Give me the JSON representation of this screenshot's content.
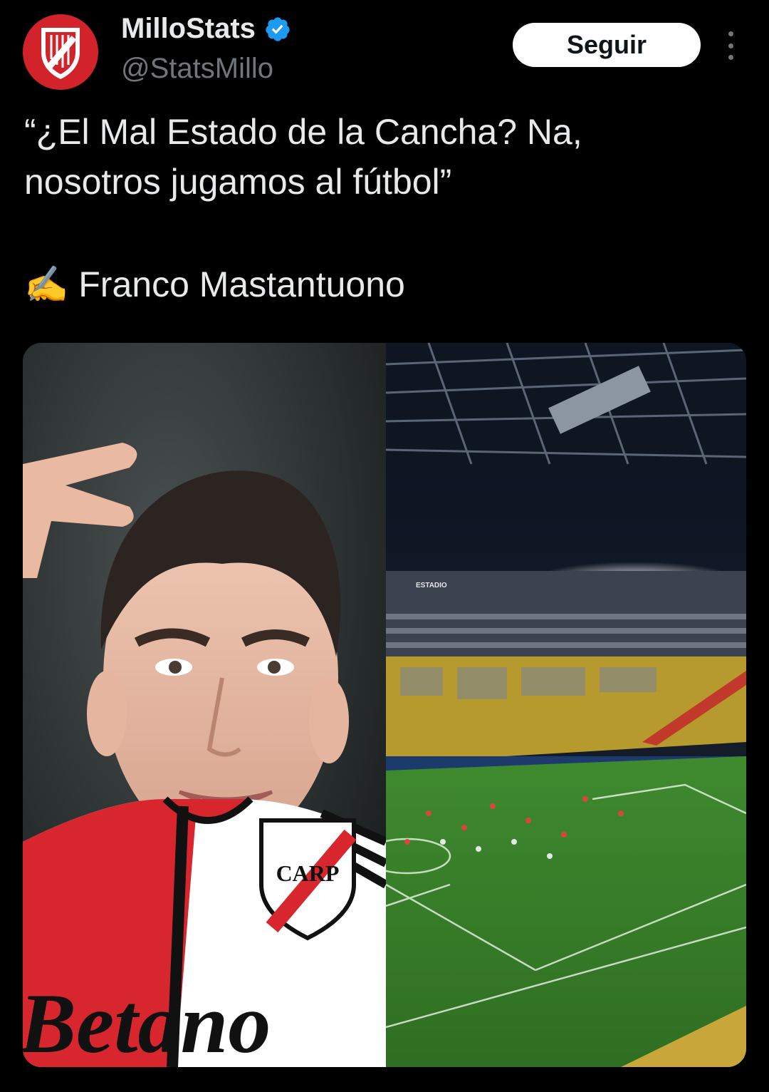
{
  "account": {
    "display_name": "MilloStats",
    "handle": "@StatsMillo",
    "verified_icon": "verified-badge-icon",
    "avatar_icon": "river-plate-crest-icon"
  },
  "follow_button": {
    "label": "Seguir"
  },
  "more_menu": {
    "icon": "more-vertical-icon"
  },
  "tweet": {
    "lines": [
      "“¿El Mal Estado de la Cancha? Na,",
      "nosotros jugamos al fútbol”"
    ],
    "author_emoji": "✍️",
    "author": "Franco Mastantuono"
  },
  "media": {
    "left_image": {
      "jersey_text": "Betano",
      "badge_text": "CARP"
    },
    "right_image": {
      "stadium_sign": "ESTADIO"
    }
  },
  "colors": {
    "background": "#000000",
    "text": "#e7e9ea",
    "secondary": "#71767b",
    "verified": "#1d9bf0",
    "avatar": "#d2232a"
  }
}
